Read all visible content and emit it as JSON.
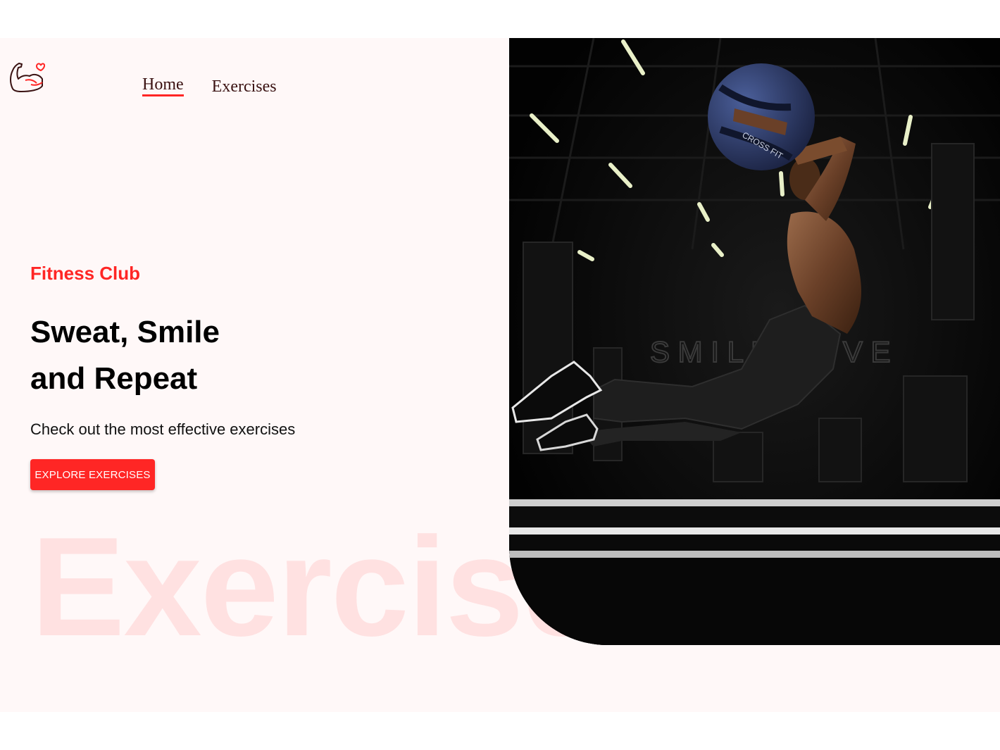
{
  "nav": {
    "items": [
      {
        "label": "Home",
        "active": true
      },
      {
        "label": "Exercises",
        "active": false
      }
    ]
  },
  "hero": {
    "kicker": "Fitness Club",
    "headline_line1": "Sweat, Smile",
    "headline_line2": "and Repeat",
    "subtitle": "Check out the most effective exercises",
    "cta_label": "EXPLORE EXERCISES",
    "watermark": "Exercise"
  },
  "colors": {
    "accent": "#ff2625",
    "page_background": "#fff8f8",
    "nav_text": "#3a1212"
  },
  "icons": {
    "logo": "flexed-arm-heart-icon"
  },
  "banner_image": "athlete-jumping-with-medicine-ball-photo"
}
